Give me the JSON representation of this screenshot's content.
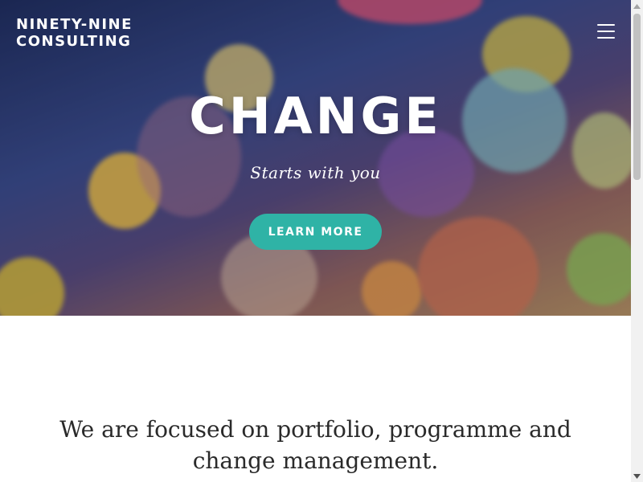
{
  "header": {
    "brand_line1": "NINETY-NINE",
    "brand_line2": "CONSULTING",
    "menu_icon": "hamburger-menu-icon"
  },
  "hero": {
    "title": "CHANGE",
    "subtitle": "Starts with you",
    "cta_label": "LEARN MORE",
    "cta_color": "#2fb3a6"
  },
  "intro": {
    "text": "We are focused on portfolio, programme and change management."
  },
  "scrollbar": {
    "up_icon": "scroll-up-arrow-icon",
    "down_icon": "scroll-down-arrow-icon"
  }
}
